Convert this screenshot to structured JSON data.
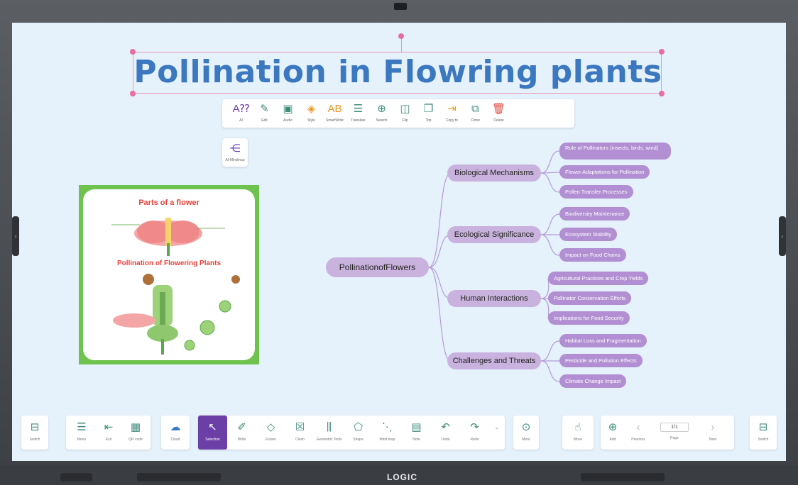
{
  "device": {
    "brand": "LOGIC"
  },
  "title": "Pollination in Flowring plants",
  "float_toolbar": [
    {
      "icon": "ai-text-icon",
      "glyph": "A⁇",
      "label": "AI",
      "color": "#6c3fa6"
    },
    {
      "icon": "edit-icon",
      "glyph": "✎",
      "label": "Edit",
      "color": "#3f8c7a"
    },
    {
      "icon": "audio-icon",
      "glyph": "▣",
      "label": "Audio",
      "color": "#3f8c7a"
    },
    {
      "icon": "style-icon",
      "glyph": "◈",
      "label": "Style",
      "color": "#e79a2a"
    },
    {
      "icon": "smartwrite-icon",
      "glyph": "AB",
      "label": "SmartWrite",
      "color": "#e79a2a"
    },
    {
      "icon": "translate-icon",
      "glyph": "☰",
      "label": "Translate",
      "color": "#3f8c7a"
    },
    {
      "icon": "search-icon",
      "glyph": "⊕",
      "label": "Search",
      "color": "#3f8c7a"
    },
    {
      "icon": "flip-icon",
      "glyph": "◫",
      "label": "Flip",
      "color": "#3f8c7a"
    },
    {
      "icon": "top-icon",
      "glyph": "❐",
      "label": "Top",
      "color": "#3f8c7a"
    },
    {
      "icon": "copy-to-icon",
      "glyph": "⇥",
      "label": "Copy to",
      "color": "#e79a2a"
    },
    {
      "icon": "clone-icon",
      "glyph": "⧉",
      "label": "Clone",
      "color": "#3f8c7a"
    },
    {
      "icon": "delete-icon",
      "glyph": "🗑",
      "label": "Delete",
      "color": "#e0443b"
    }
  ],
  "ai_mindmap": {
    "glyph": "⋲",
    "label": "AI-Mindmap"
  },
  "flower_card": {
    "heading1": "Parts of a flower",
    "heading2": "Pollination of Flowering Plants"
  },
  "mindmap": {
    "root": "PollinationofFlowers",
    "branches": [
      {
        "label": "Biological Mechanisms",
        "children": [
          "Role of Pollinators (insects, birds, wind)",
          "Flower Adaptations for Pollination",
          "Pollen Transfer Processes"
        ]
      },
      {
        "label": "Ecological Significance",
        "children": [
          "Biodiversity Maintenance",
          "Ecosystem Stability",
          "Impact on Food Chains"
        ]
      },
      {
        "label": "Human Interactions",
        "children": [
          "Agricultural Practices and Crop Yields",
          "Pollinator Conservation Efforts",
          "Implications for Food Security"
        ]
      },
      {
        "label": "Challenges and Threats",
        "children": [
          "Habitat Loss and Fragmentation",
          "Pesticide and Pollution Effects",
          "Climate Change Impact"
        ]
      }
    ]
  },
  "bottom_toolbar": {
    "switch_left": {
      "glyph": "⊟",
      "label": "Switch"
    },
    "group1": [
      {
        "name": "menu",
        "glyph": "☰",
        "label": "Menu"
      },
      {
        "name": "exit",
        "glyph": "⇤",
        "label": "Exit"
      },
      {
        "name": "qr-code",
        "glyph": "▦",
        "label": "QR code"
      }
    ],
    "cloud": {
      "glyph": "☁",
      "label": "Cloud"
    },
    "tools": [
      {
        "name": "selection",
        "glyph": "↖",
        "label": "Selection"
      },
      {
        "name": "write",
        "glyph": "✐",
        "label": "Write"
      },
      {
        "name": "eraser",
        "glyph": "◇",
        "label": "Eraser"
      },
      {
        "name": "clean",
        "glyph": "☒",
        "label": "Clean"
      },
      {
        "name": "geometric-tools",
        "glyph": "⫼",
        "label": "Geometric Tools"
      },
      {
        "name": "shape",
        "glyph": "⬠",
        "label": "Shape"
      },
      {
        "name": "mind-map",
        "glyph": "⋱",
        "label": "Mind map"
      },
      {
        "name": "note",
        "glyph": "▤",
        "label": "Note"
      },
      {
        "name": "undo",
        "glyph": "↶",
        "label": "Undo"
      },
      {
        "name": "redo",
        "glyph": "↷",
        "label": "Redo"
      }
    ],
    "more": {
      "glyph": "⊙",
      "label": "More"
    },
    "move": {
      "glyph": "☝",
      "label": "Move"
    },
    "pager": {
      "add": "Add",
      "previous": "Previous",
      "page_value": "1/1",
      "page_label": "Page",
      "next": "Next"
    },
    "switch_right": {
      "glyph": "⊟",
      "label": "Switch"
    }
  }
}
